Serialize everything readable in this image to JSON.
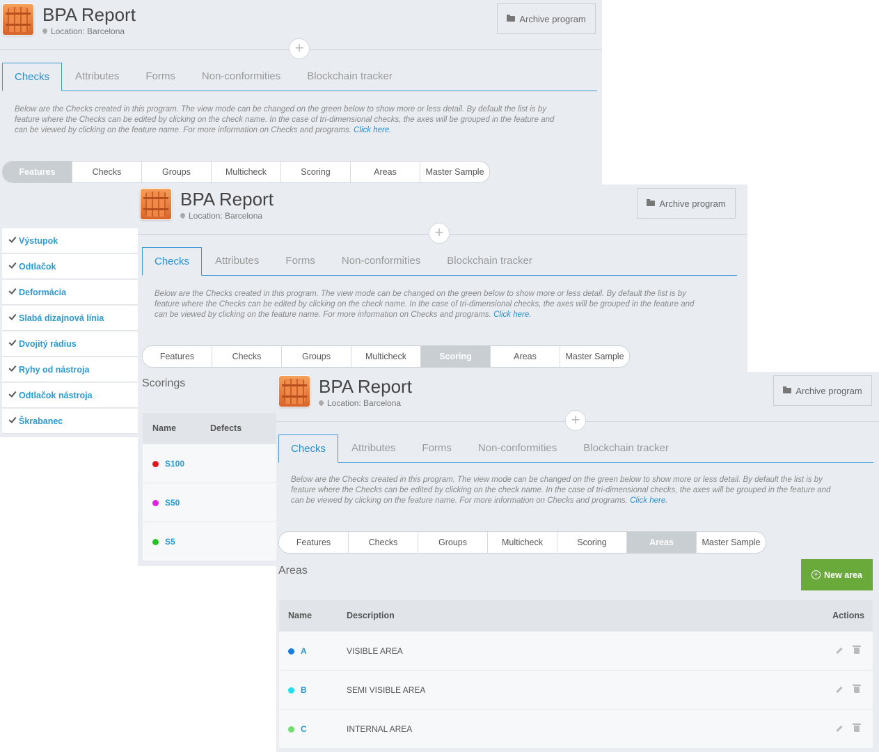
{
  "header": {
    "title": "BPA Report",
    "location": "Location: Barcelona",
    "archive_label": "Archive program"
  },
  "tabs": [
    "Checks",
    "Attributes",
    "Forms",
    "Non-conformities",
    "Blockchain tracker"
  ],
  "description": {
    "line1": "Below are the Checks created in this program. The view mode can be changed on the green below to show more or less detail. By default the list is by",
    "line2": "feature where the Checks can be edited by clicking on the check name. In the case of tri-dimensional checks, the axes will be grouped in the feature and",
    "line3": "can be viewed by clicking on the feature name. For more information on Checks and programs.",
    "link": "Click here."
  },
  "view_modes": [
    "Features",
    "Checks",
    "Groups",
    "Multicheck",
    "Scoring",
    "Areas",
    "Master Sample"
  ],
  "panel1": {
    "selected_mode": "Features",
    "features": [
      "Výstupok",
      "Odtlačok",
      "Deformácia",
      "Slabá dizajnová línia",
      "Dvojitý rádius",
      "Ryhy od nástroja",
      "Odtlačok nástroja",
      "Škrabanec"
    ]
  },
  "panel2": {
    "selected_mode": "Scoring",
    "section_title": "Scorings",
    "columns": {
      "name": "Name",
      "defects": "Defects"
    },
    "rows": [
      {
        "name": "S100",
        "color": "#e0191d"
      },
      {
        "name": "S50",
        "color": "#e020e0"
      },
      {
        "name": "S5",
        "color": "#22c322"
      }
    ]
  },
  "panel3": {
    "selected_mode": "Areas",
    "section_title": "Areas",
    "new_button": "New area",
    "columns": {
      "name": "Name",
      "description": "Description",
      "actions": "Actions"
    },
    "rows": [
      {
        "name": "A",
        "description": "VISIBLE AREA",
        "color": "#1a7fe0"
      },
      {
        "name": "B",
        "description": "SEMI VISIBLE AREA",
        "color": "#20e0f0"
      },
      {
        "name": "C",
        "description": "INTERNAL AREA",
        "color": "#6fe06f"
      }
    ]
  },
  "icons": {
    "pin": "map-pin-icon",
    "archive": "folder-icon",
    "plus": "plus-icon",
    "check": "checkmark-icon",
    "edit": "pencil-icon",
    "delete": "trash-icon"
  }
}
